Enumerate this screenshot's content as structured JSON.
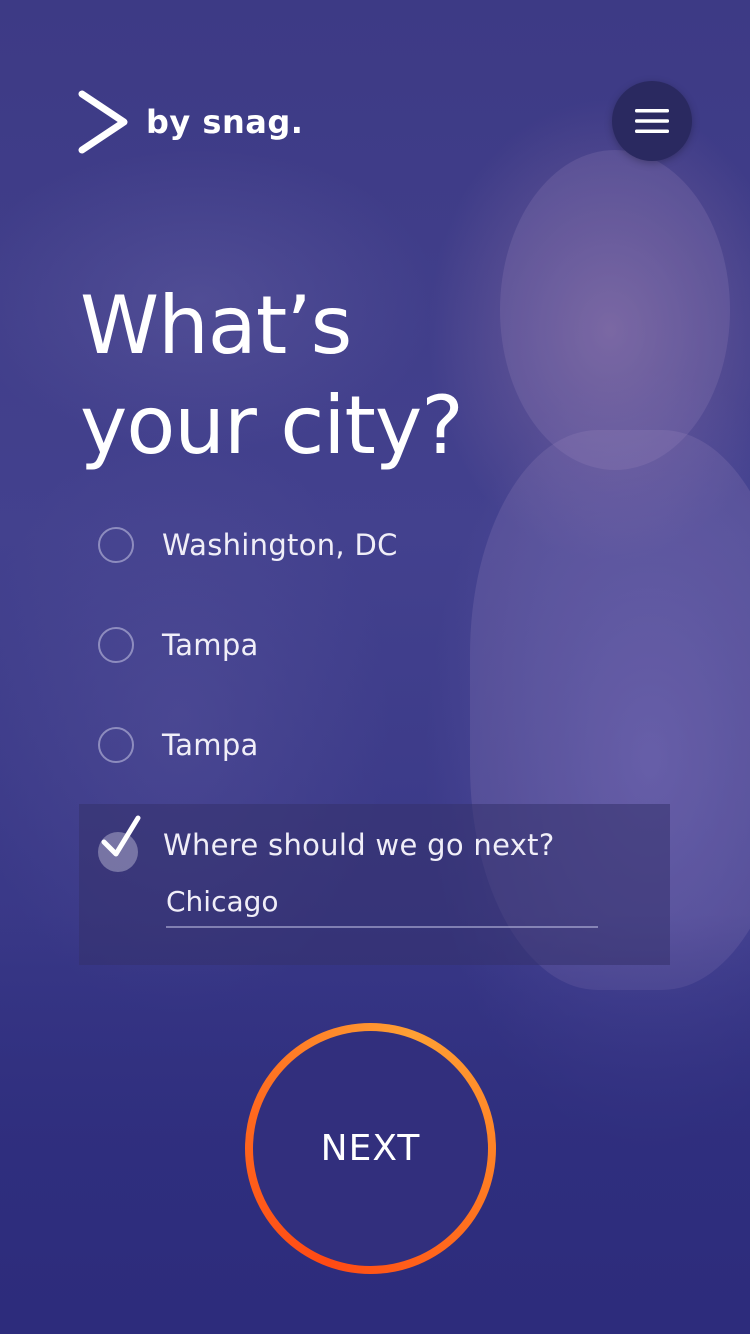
{
  "brand": {
    "name": "by snag.",
    "logo_icon": "chevron-right-icon"
  },
  "header": {
    "menu_icon": "hamburger-menu-icon"
  },
  "question": {
    "title_line1": "What’s",
    "title_line2": "your city?"
  },
  "options": [
    {
      "label": "Washington, DC",
      "selected": false
    },
    {
      "label": "Tampa",
      "selected": false
    },
    {
      "label": "Tampa",
      "selected": false
    }
  ],
  "other_option": {
    "label": "Where should we go next?",
    "selected": true,
    "input_value": "Chicago"
  },
  "next_button": {
    "label": "NEXT"
  },
  "colors": {
    "background": "#3b3a86",
    "button_ring_start": "#ff4a14",
    "button_ring_end": "#ffa034",
    "menu_button": "#2a2960"
  }
}
